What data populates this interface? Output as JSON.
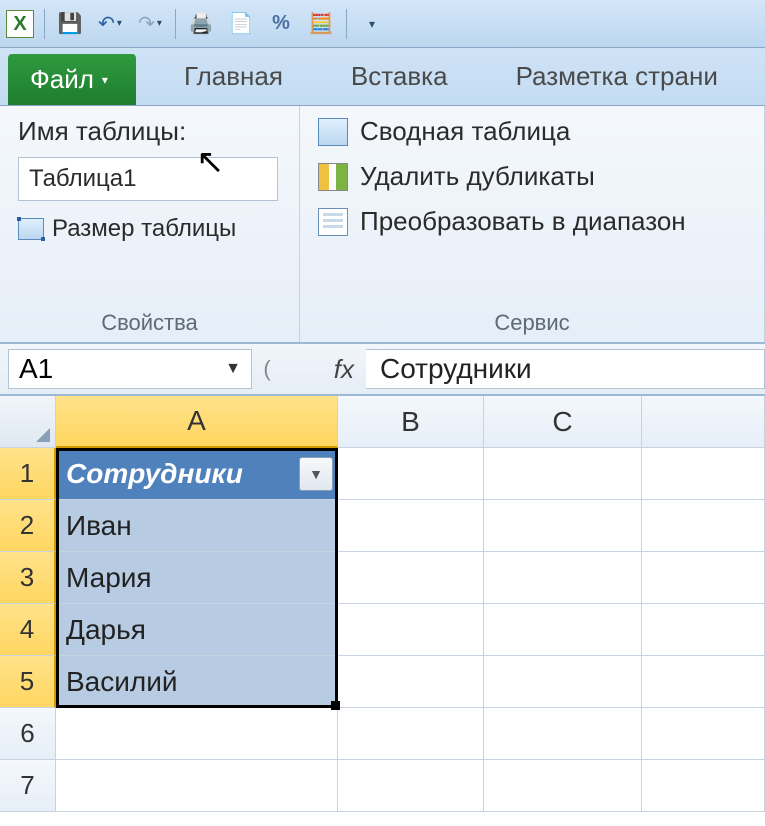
{
  "app_hint": "X",
  "tabs": {
    "file": "Файл",
    "home": "Главная",
    "insert": "Вставка",
    "layout": "Разметка страни"
  },
  "ribbon": {
    "properties": {
      "title": "Имя таблицы:",
      "table_name": "Таблица1",
      "resize_label": "Размер таблицы",
      "group_label": "Свойства"
    },
    "tools": {
      "pivot": "Сводная таблица",
      "remove_dups": "Удалить дубликаты",
      "convert_range": "Преобразовать в диапазон",
      "group_label": "Сервис"
    }
  },
  "formula_bar": {
    "cell_ref": "A1",
    "fx": "fx",
    "formula_value": "Сотрудники"
  },
  "columns": [
    "A",
    "B",
    "C"
  ],
  "rows": [
    "1",
    "2",
    "3",
    "4",
    "5",
    "6",
    "7"
  ],
  "table": {
    "header": "Сотрудники",
    "data": [
      "Иван",
      "Мария",
      "Дарья",
      "Василий"
    ]
  }
}
